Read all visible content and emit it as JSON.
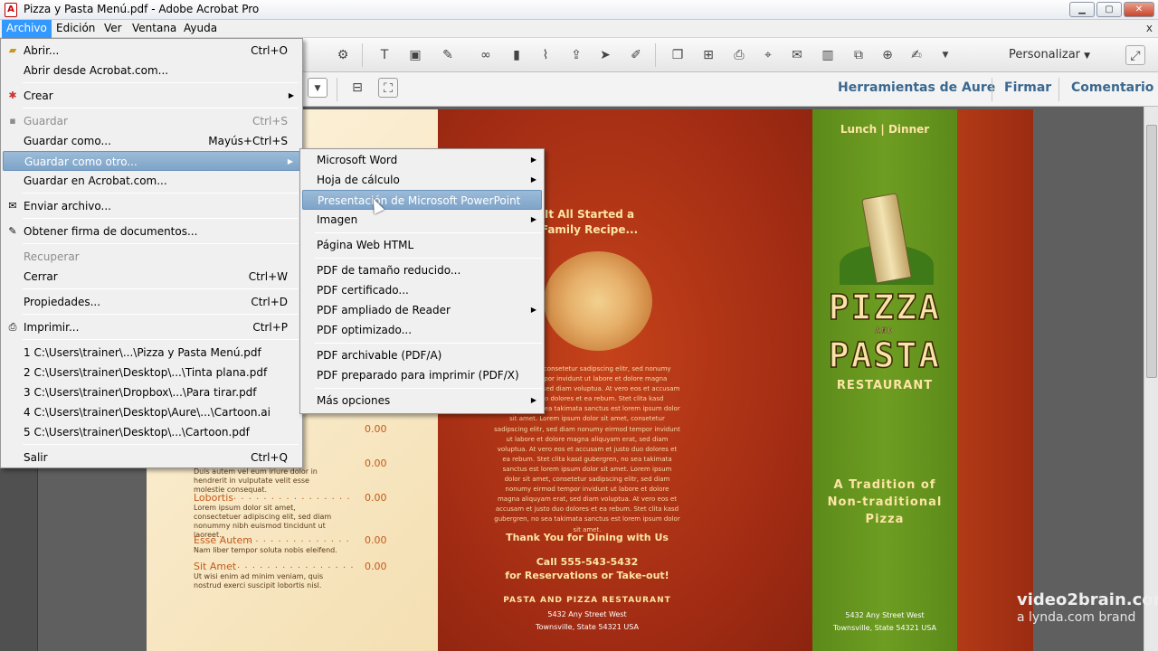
{
  "window": {
    "title": "Pizza y Pasta Menú.pdf - Adobe Acrobat Pro",
    "app_icon": "pdf-icon",
    "minimize": "▁",
    "maximize": "▢",
    "close": "✕"
  },
  "menubar": {
    "items": [
      "Archivo",
      "Edición",
      "Ver",
      "Ventana",
      "Ayuda"
    ],
    "active": "Archivo",
    "doc_close": "x"
  },
  "toolbar": {
    "personalizar": "Personalizar",
    "panel_links": [
      "Herramientas de Aure",
      "Firmar",
      "Comentario"
    ]
  },
  "file_menu": {
    "items": [
      {
        "label": "Abrir...",
        "shortcut": "Ctrl+O",
        "icon": "open-icon"
      },
      {
        "label": "Abrir desde Acrobat.com...",
        "shortcut": ""
      },
      {
        "label": "Crear",
        "shortcut": "",
        "submenu": true,
        "icon": "create-icon"
      },
      {
        "label": "Guardar",
        "shortcut": "Ctrl+S",
        "disabled": true,
        "icon": "save-icon"
      },
      {
        "label": "Guardar como...",
        "shortcut": "Mayús+Ctrl+S"
      },
      {
        "label": "Guardar como otro...",
        "shortcut": "",
        "submenu": true,
        "highlighted": true
      },
      {
        "label": "Guardar en Acrobat.com...",
        "shortcut": ""
      },
      {
        "label": "Enviar archivo...",
        "shortcut": "",
        "icon": "mail-icon"
      },
      {
        "label": "Obtener firma de documentos...",
        "shortcut": "",
        "icon": "sign-icon"
      },
      {
        "label": "Recuperar",
        "shortcut": "",
        "disabled": true
      },
      {
        "label": "Cerrar",
        "shortcut": "Ctrl+W"
      },
      {
        "label": "Propiedades...",
        "shortcut": "Ctrl+D"
      },
      {
        "label": "Imprimir...",
        "shortcut": "Ctrl+P",
        "icon": "print-icon"
      },
      {
        "label": "1 C:\\Users\\trainer\\...\\Pizza y Pasta Menú.pdf",
        "shortcut": ""
      },
      {
        "label": "2 C:\\Users\\trainer\\Desktop\\...\\Tinta plana.pdf",
        "shortcut": ""
      },
      {
        "label": "3 C:\\Users\\trainer\\Dropbox\\...\\Para tirar.pdf",
        "shortcut": ""
      },
      {
        "label": "4 C:\\Users\\trainer\\Desktop\\Aure\\...\\Cartoon.ai",
        "shortcut": ""
      },
      {
        "label": "5 C:\\Users\\trainer\\Desktop\\...\\Cartoon.pdf",
        "shortcut": ""
      },
      {
        "label": "Salir",
        "shortcut": "Ctrl+Q"
      }
    ]
  },
  "save_as_submenu": {
    "items": [
      {
        "label": "Microsoft Word",
        "submenu": true
      },
      {
        "label": "Hoja de cálculo",
        "submenu": true
      },
      {
        "label": "Presentación de Microsoft PowerPoint",
        "highlighted": true
      },
      {
        "label": "Imagen",
        "submenu": true
      },
      {
        "label": "Página Web HTML"
      },
      {
        "label": "PDF de tamaño reducido..."
      },
      {
        "label": "PDF certificado..."
      },
      {
        "label": "PDF ampliado de Reader",
        "submenu": true
      },
      {
        "label": "PDF optimizado..."
      },
      {
        "label": "PDF archivable (PDF/A)"
      },
      {
        "label": "PDF preparado para imprimir (PDF/X)"
      },
      {
        "label": "Más opciones",
        "submenu": true
      }
    ]
  },
  "document": {
    "left_panel": {
      "items": [
        {
          "name": "",
          "price": "0.00",
          "desc": ""
        },
        {
          "name": "",
          "price": "0.00",
          "desc": "Duis autem vel eum iriure dolor in hendrerit in vulputate velit esse molestie consequat."
        },
        {
          "name": "Lobortis",
          "price": "0.00",
          "desc": "Lorem ipsum dolor sit amet, consectetuer adipiscing elit, sed diam nonummy nibh euismod tincidunt ut laoreet."
        },
        {
          "name": "Esse Autem",
          "price": "0.00",
          "desc": "Nam liber tempor soluta nobis eleifend."
        },
        {
          "name": "Sit Amet",
          "price": "0.00",
          "desc": "Ut wisi enim ad minim veniam, quis nostrud exerci suscipit lobortis nisl."
        }
      ]
    },
    "middle_panel": {
      "headline": "It All Started a Family Recipe...",
      "lorem": "lor sit amet, consetetur sadipscing elitr, sed nonumy eirmod tempor invidunt ut labore et dolore magna aliquyam erat, sed diam voluptua. At vero eos et accusam et justo duo dolores et ea rebum. Stet clita kasd gubergren, no sea takimata sanctus est lorem ipsum dolor sit amet. Lorem ipsum dolor sit amet, consetetur sadipscing elitr, sed diam nonumy eirmod tempor invidunt ut labore et dolore magna aliquyam erat, sed diam voluptua. At vero eos et accusam et justo duo dolores et ea rebum. Stet clita kasd gubergren, no sea takimata sanctus est lorem ipsum dolor sit amet. Lorem ipsum dolor sit amet, consetetur sadipscing elitr, sed diam nonumy eirmod tempor invidunt ut labore et dolore magna aliquyam erat, sed diam voluptua. At vero eos et accusam et justo duo dolores et ea rebum. Stet clita kasd gubergren, no sea takimata sanctus est lorem ipsum dolor sit amet.",
      "thanks": "Thank You for Dining with Us",
      "call": "Call 555-543-5432",
      "reservations": "for Reservations or Take-out!",
      "restaurant": "PASTA AND PIZZA RESTAURANT",
      "address1": "5432 Any Street West",
      "address2": "Townsville, State 54321 USA"
    },
    "right_panel": {
      "hours": "Lunch | Dinner",
      "logo_line1": "PIZZA",
      "logo_and": "AND",
      "logo_line2": "PASTA",
      "logo_line3": "RESTAURANT",
      "tagline": "A Tradition of Non-traditional Pizza",
      "address1": "5432 Any Street West",
      "address2": "Townsville, State 54321 USA"
    }
  },
  "watermark": {
    "line1": "video2brain.com",
    "line2": "a lynda.com brand"
  }
}
